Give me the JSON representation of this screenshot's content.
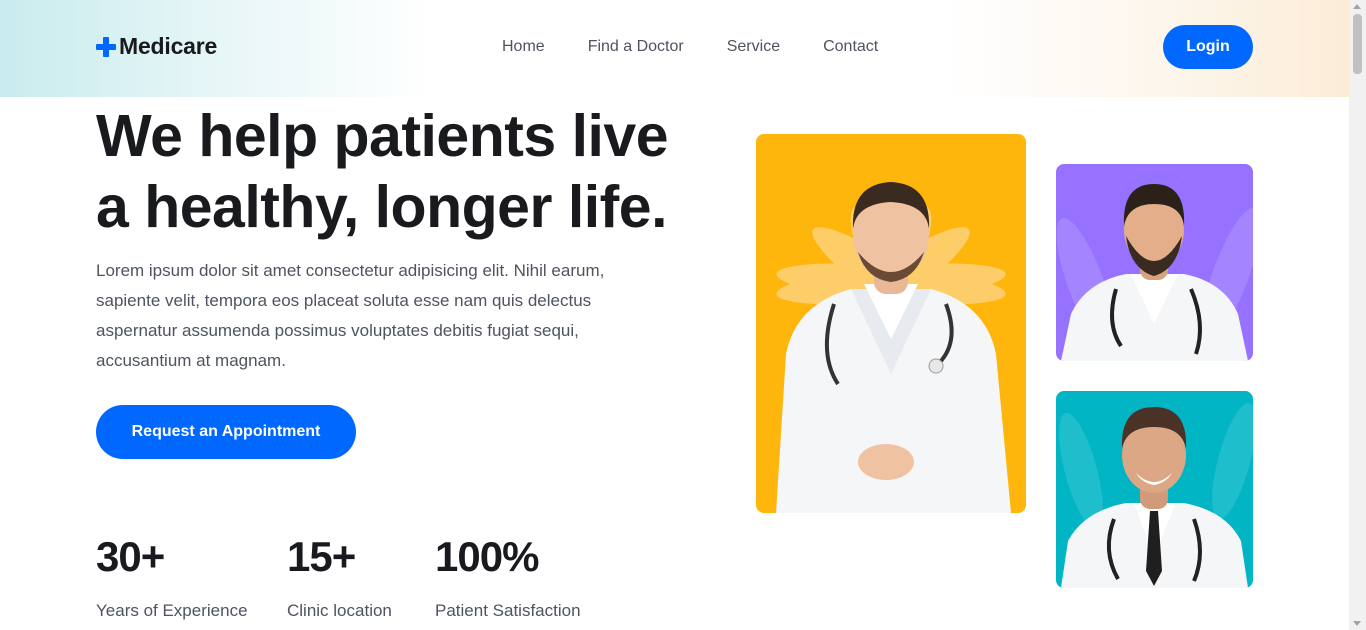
{
  "brand": {
    "name": "Medicare",
    "icon": "plus-icon",
    "color": "#0067ff"
  },
  "nav": {
    "items": [
      "Home",
      "Find a Doctor",
      "Service",
      "Contact"
    ]
  },
  "header": {
    "login_label": "Login"
  },
  "hero": {
    "title_line1": "We help patients live",
    "title_line2": "a healthy, longer life.",
    "description": "Lorem ipsum dolor sit amet consectetur adipisicing elit. Nihil earum, sapiente velit, tempora eos placeat soluta esse nam quis delectus aspernatur assumenda possimus voluptates debitis fugiat sequi, accusantium at magnam.",
    "cta_label": "Request an Appointment"
  },
  "stats": [
    {
      "value": "30+",
      "label": "Years of Experience",
      "color": "#feb60d"
    },
    {
      "value": "15+",
      "label": "Clinic location",
      "color": "#9771ff"
    },
    {
      "value": "100%",
      "label": "Patient Satisfaction",
      "color": "#01b5c5"
    }
  ],
  "doctor_photos": [
    {
      "icon": "doctor-photo",
      "background": "#feb60d"
    },
    {
      "icon": "doctor-photo",
      "background": "#9771ff"
    },
    {
      "icon": "doctor-photo",
      "background": "#01b5c5"
    }
  ]
}
